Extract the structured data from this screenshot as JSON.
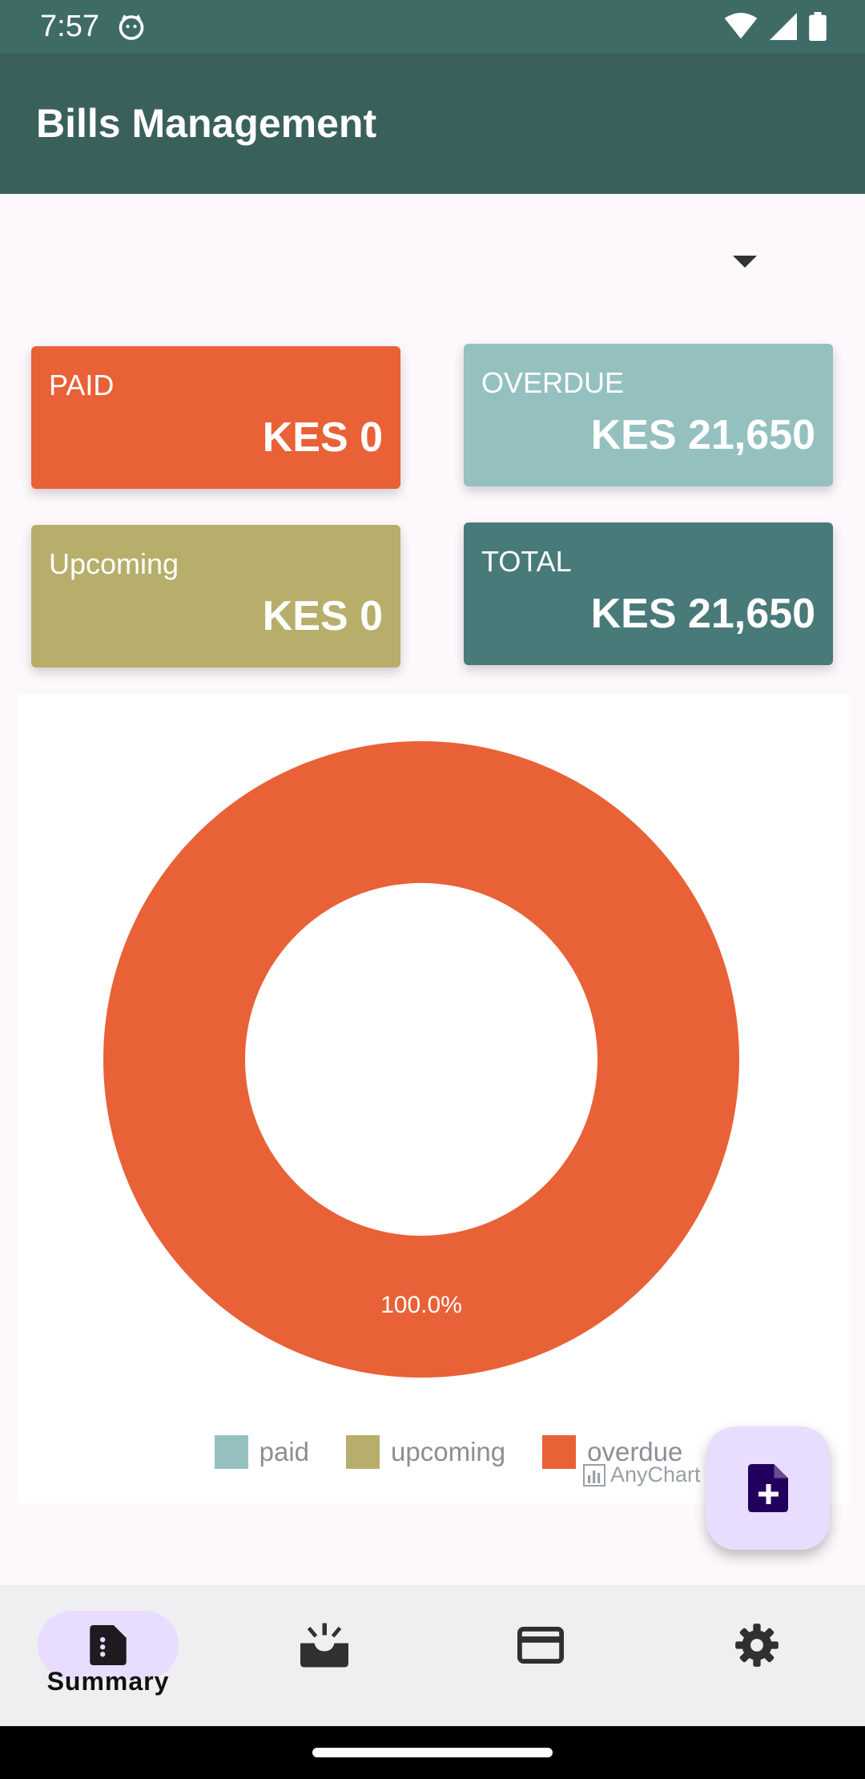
{
  "status": {
    "time": "7:57"
  },
  "app": {
    "title": "Bills Management"
  },
  "cards": {
    "paid": {
      "label": "PAID",
      "value": "KES 0"
    },
    "overdue": {
      "label": "OVERDUE",
      "value": "KES 21,650"
    },
    "upcoming": {
      "label": "Upcoming",
      "value": "KES 0"
    },
    "total": {
      "label": "TOTAL",
      "value": "KES 21,650"
    }
  },
  "chart_data": {
    "type": "pie",
    "categories": [
      "paid",
      "upcoming",
      "overdue"
    ],
    "values": [
      0,
      0,
      21650
    ],
    "colors": [
      "#94c1bf",
      "#b7ae6b",
      "#e96137"
    ],
    "slice_label": "100.0%",
    "legend_position": "bottom",
    "credit": "AnyChart"
  },
  "nav": {
    "items": [
      {
        "label": "Summary",
        "icon": "summary-icon",
        "active": true
      },
      {
        "label": "",
        "icon": "inbox-icon",
        "active": false
      },
      {
        "label": "",
        "icon": "credit-card-icon",
        "active": false
      },
      {
        "label": "",
        "icon": "gear-icon",
        "active": false
      }
    ]
  },
  "colors": {
    "status_bar": "#3f6b67",
    "app_bar": "#3a605c",
    "paid": "#e96137",
    "overdue": "#94c1bf",
    "upcoming": "#b7ae6b",
    "total": "#487a79",
    "fab": "#e9ddff"
  }
}
